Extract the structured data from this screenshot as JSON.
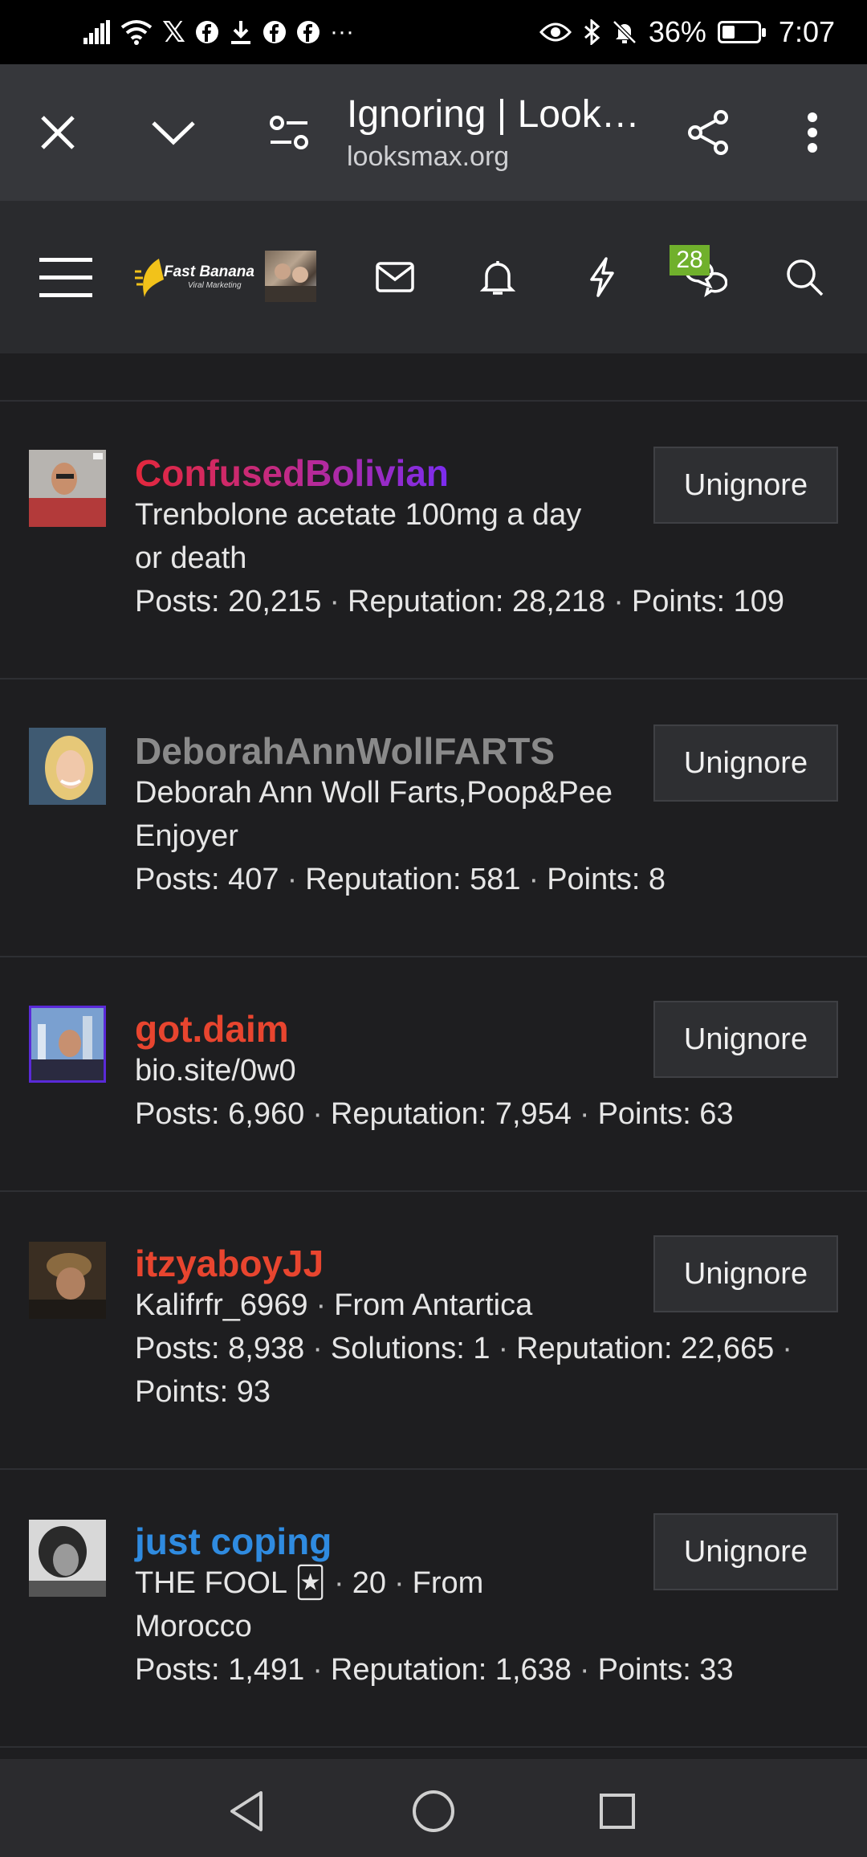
{
  "status_bar": {
    "battery": "36%",
    "time": "7:07",
    "battery_level": 0.36,
    "left_icons": [
      "signal-icon",
      "wifi-icon",
      "x-icon",
      "facebook-icon",
      "download-icon",
      "facebook-icon",
      "facebook-icon",
      "more-icon"
    ],
    "right_icons": [
      "eye-icon",
      "bluetooth-icon",
      "bell-off-icon",
      "battery-icon"
    ]
  },
  "browser": {
    "title": "Ignoring | Look…",
    "url": "looksmax.org"
  },
  "site_nav": {
    "logo_text": "Fast Banana",
    "logo_sub": "Viral Marketing",
    "chat_badge": "28"
  },
  "users": [
    {
      "name": "ConfusedBolivian",
      "name_style": "gradient-red-purple",
      "line1": "Trenbolone acetate 100mg a day",
      "line2": "or death",
      "stats": [
        "Posts: 20,215",
        "Reputation: 28,218",
        "Points: 109"
      ],
      "button": "Unignore"
    },
    {
      "name": "DeborahAnnWollFARTS",
      "name_color": "#8a8a8a",
      "line1": "Deborah Ann Woll Farts,Poop&Pee",
      "line2": "Enjoyer",
      "stats": [
        "Posts: 407",
        "Reputation: 581",
        "Points: 8"
      ],
      "button": "Unignore"
    },
    {
      "name": "got.daim",
      "name_color": "#e8452f",
      "line1": "bio.site/0w0",
      "stats": [
        "Posts: 6,960",
        "Reputation: 7,954",
        "Points: 63"
      ],
      "button": "Unignore"
    },
    {
      "name": "itzyaboyJJ",
      "name_color": "#e8452f",
      "line1_parts": [
        "Kalifrfr_6969",
        "From Antartica"
      ],
      "stats": [
        "Posts: 8,938",
        "Solutions: 1",
        "Reputation: 22,665"
      ],
      "stats2": "Points: 93",
      "button": "Unignore"
    },
    {
      "name": "just coping",
      "name_color": "#2f8be0",
      "line1_parts": [
        "THE FOOL 🃏",
        "20",
        "From"
      ],
      "line2": "Morocco",
      "stats": [
        "Posts: 1,491",
        "Reputation: 1,638",
        "Points: 33"
      ],
      "button": "Unignore"
    }
  ]
}
